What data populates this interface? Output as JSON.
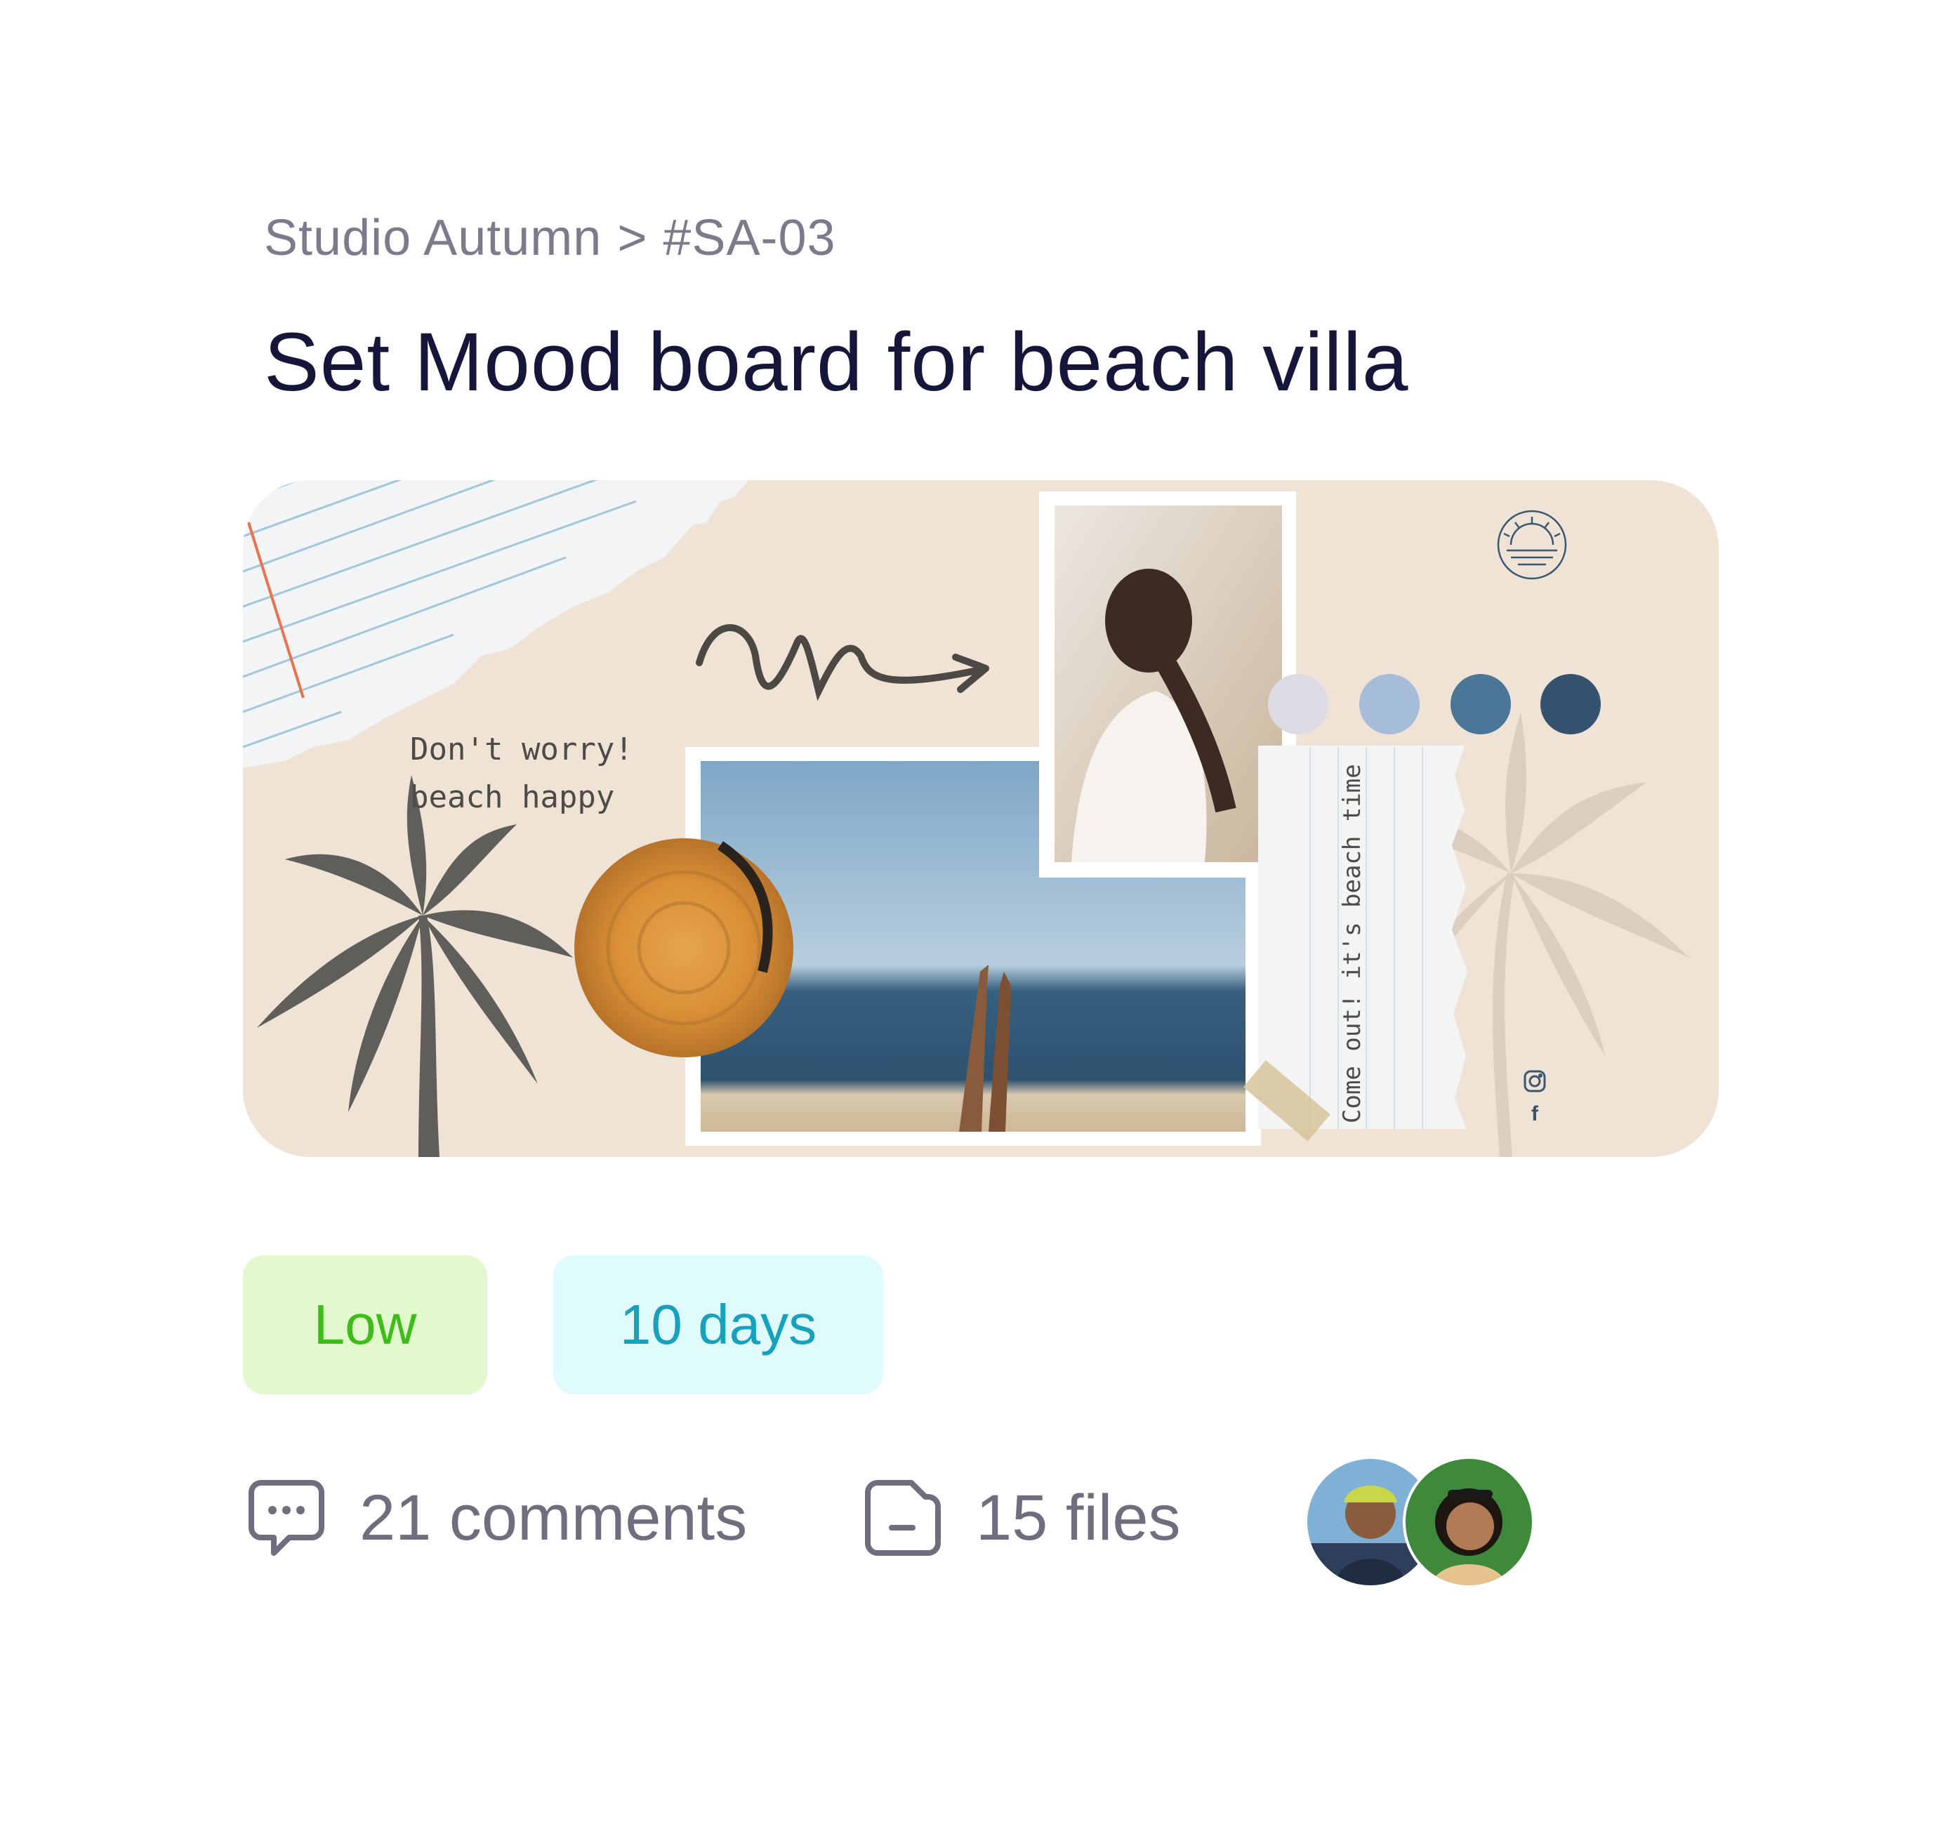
{
  "breadcrumb": {
    "project": "Studio Autumn",
    "separator": ">",
    "task_id": "#SA-03"
  },
  "task": {
    "title": "Set Mood board for beach villa"
  },
  "moodboard": {
    "quote_line1": "Don't worry!",
    "quote_line2": "beach happy",
    "note_text": "Come out! it's beach time",
    "palette": [
      "#dcdbe3",
      "#a5bdd9",
      "#4c7697",
      "#35526f"
    ],
    "social_icons": [
      "instagram-icon",
      "facebook-icon"
    ],
    "facebook_glyph": "f"
  },
  "tags": {
    "priority": "Low",
    "duration": "10 days",
    "priority_color": "#3dbd18",
    "duration_color": "#16a2bd"
  },
  "meta": {
    "comments": "21 comments",
    "files": "15 files",
    "icons": [
      "comment-icon",
      "file-icon"
    ]
  },
  "assignees": [
    "avatar-1",
    "avatar-2"
  ]
}
